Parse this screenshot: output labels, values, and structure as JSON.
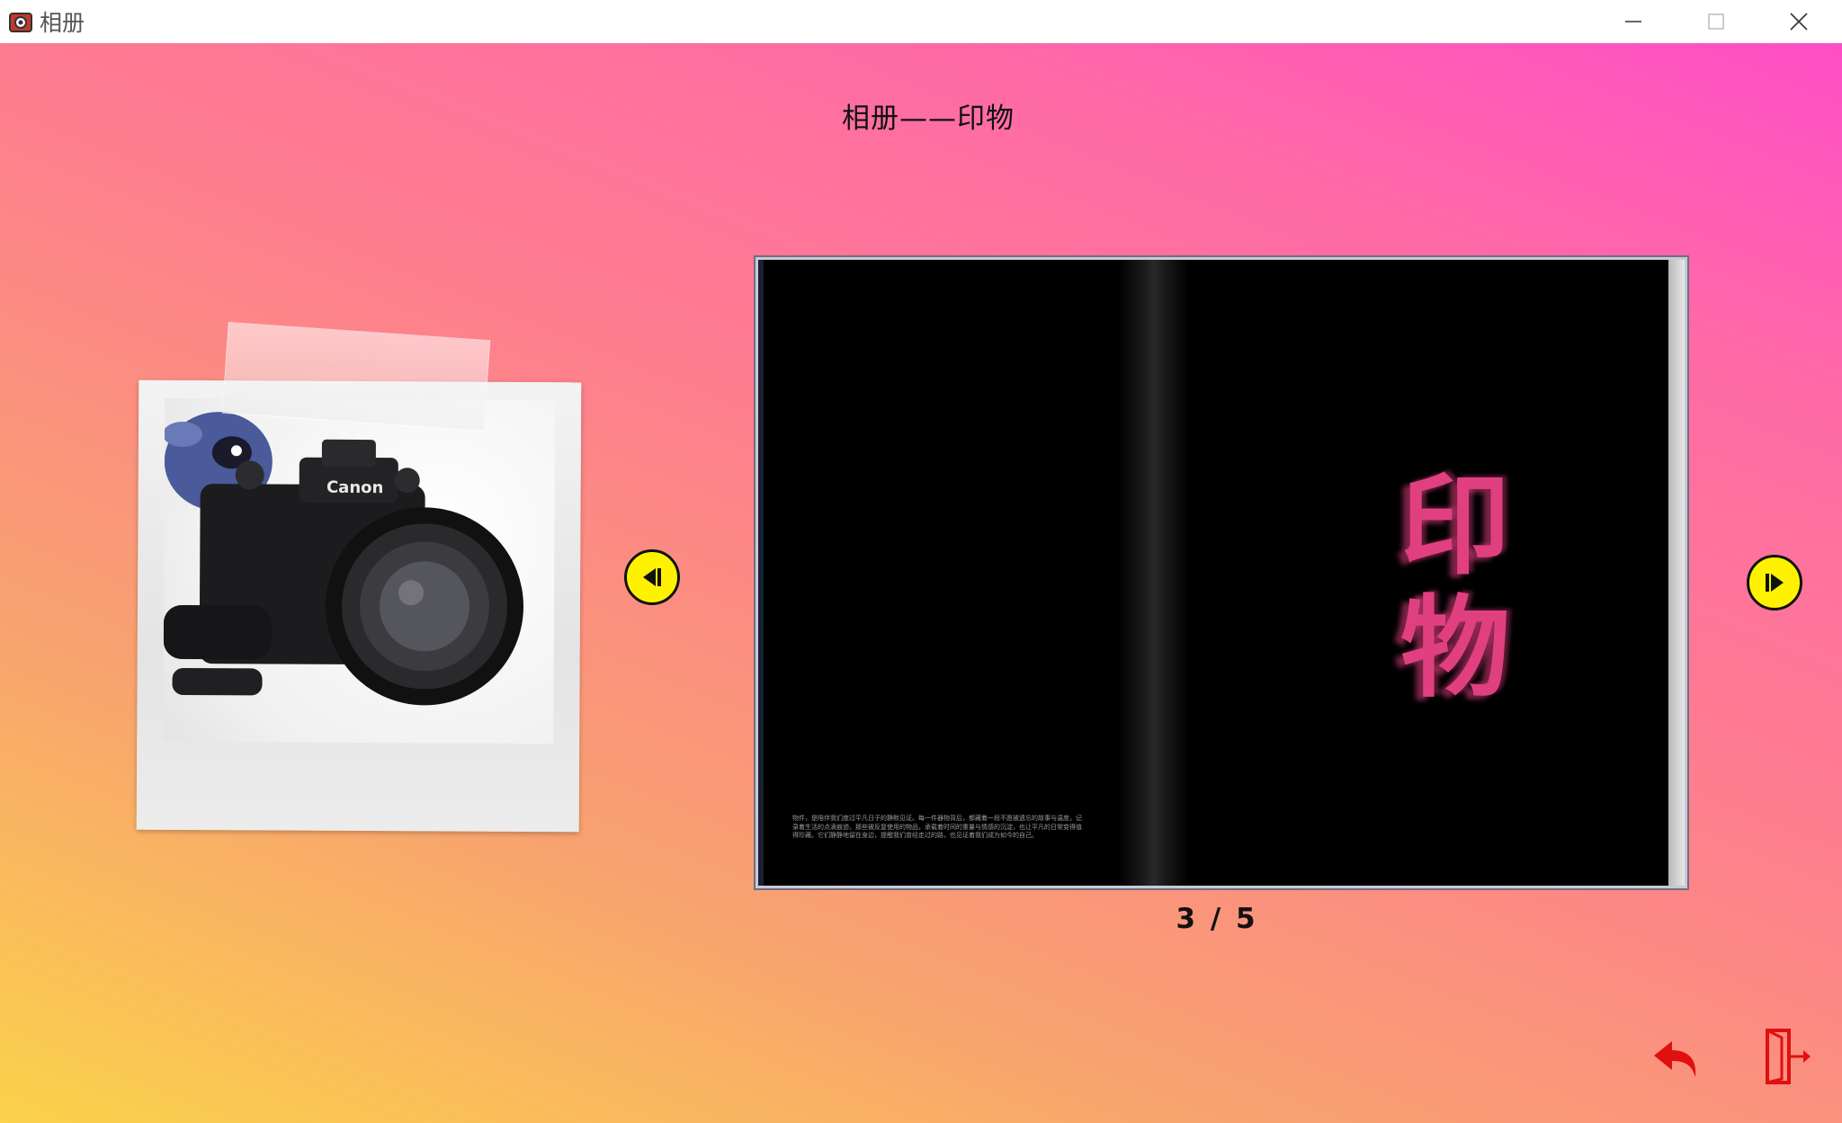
{
  "window": {
    "title": "相册",
    "controls": [
      "minimize-icon",
      "maximize-icon",
      "close-icon"
    ]
  },
  "main": {
    "title": "相册——印物",
    "photo": {
      "camera_brand": "Canon"
    },
    "book": {
      "cover_title_line1": "印",
      "cover_title_line2": "物",
      "body_text": "物件，是陪伴我们度过平凡日子的静默见证。每一件器物背后，都藏着一段不愿被遗忘的故事与温度，记录着生活的点滴痕迹。那些被反复使用的物品，承载着时间的重量与情感的沉淀，也让平凡的日常变得值得珍藏。它们静静地留在身边，提醒我们曾经走过的路，也见证着我们成为如今的自己。"
    },
    "pagination": {
      "label": "3 / 5",
      "current": 3,
      "total": 5
    },
    "nav": {
      "prev_icon": "prev-arrow-icon",
      "next_icon": "next-arrow-icon"
    },
    "actions": {
      "back_icon": "undo-arrow-icon",
      "exit_icon": "exit-door-icon"
    },
    "colors": {
      "nav_button": "#fff200",
      "cover_title": "#e0407f",
      "action_icon": "#e01010"
    }
  }
}
